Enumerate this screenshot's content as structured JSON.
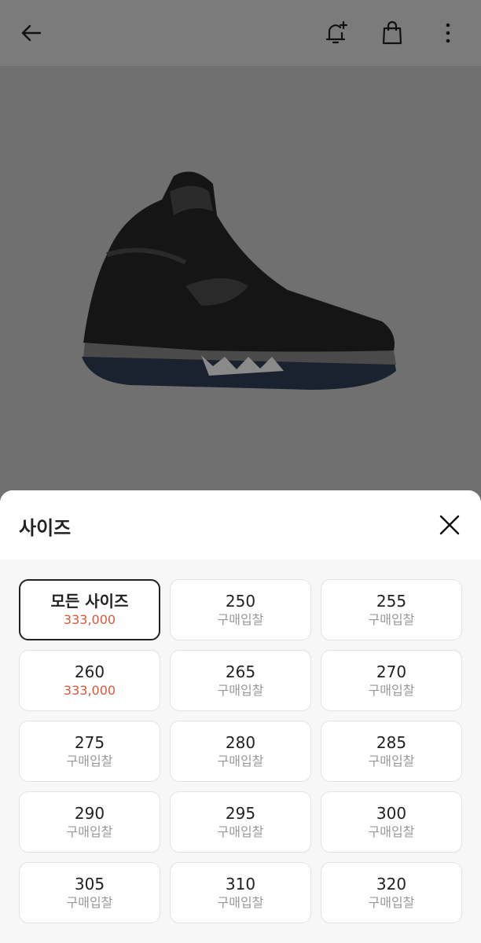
{
  "sheet": {
    "title": "사이즈"
  },
  "sizes": [
    {
      "size": "모든 사이즈",
      "price": "333,000",
      "highlight": true,
      "selected": true
    },
    {
      "size": "250",
      "price": "구매입찰",
      "highlight": false
    },
    {
      "size": "255",
      "price": "구매입찰",
      "highlight": false
    },
    {
      "size": "260",
      "price": "333,000",
      "highlight": true
    },
    {
      "size": "265",
      "price": "구매입찰",
      "highlight": false
    },
    {
      "size": "270",
      "price": "구매입찰",
      "highlight": false
    },
    {
      "size": "275",
      "price": "구매입찰",
      "highlight": false
    },
    {
      "size": "280",
      "price": "구매입찰",
      "highlight": false
    },
    {
      "size": "285",
      "price": "구매입찰",
      "highlight": false
    },
    {
      "size": "290",
      "price": "구매입찰",
      "highlight": false
    },
    {
      "size": "295",
      "price": "구매입찰",
      "highlight": false
    },
    {
      "size": "300",
      "price": "구매입찰",
      "highlight": false
    },
    {
      "size": "305",
      "price": "구매입찰",
      "highlight": false
    },
    {
      "size": "310",
      "price": "구매입찰",
      "highlight": false
    },
    {
      "size": "320",
      "price": "구매입찰",
      "highlight": false
    }
  ],
  "colors": {
    "highlight_price": "#d35a3c",
    "muted_price": "#999999",
    "overlay": "#707070"
  },
  "icons": {
    "back": "arrow-left-icon",
    "bell": "bell-plus-icon",
    "bag": "shopping-bag-icon",
    "more": "more-vertical-icon",
    "close": "close-icon"
  }
}
